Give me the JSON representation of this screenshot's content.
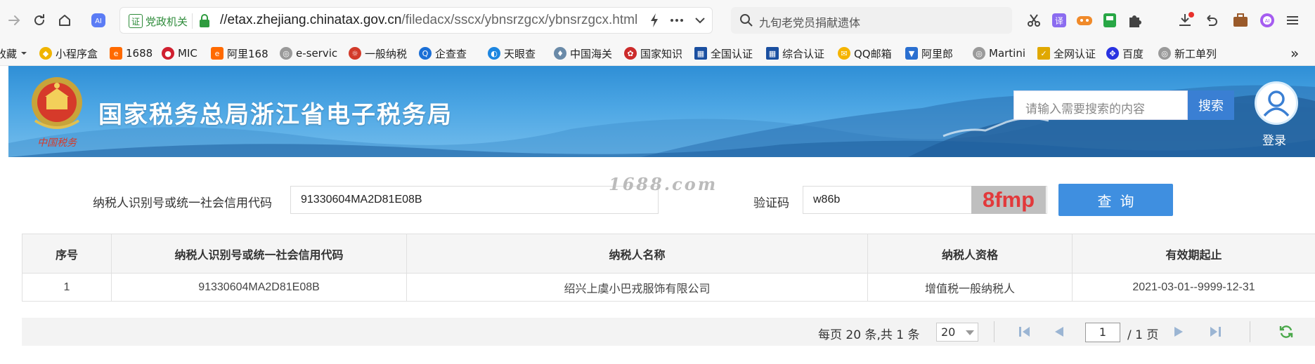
{
  "browser": {
    "address_badge": "党政机关",
    "address_badge_icon": "证",
    "url_host": "//etax.zhejiang.chinatax.gov.cn",
    "url_path": "/filedacx/sscx/ybnsrzgcx/ybnsrzgcx.html",
    "search_placeholder": "九旬老党员捐献遗体"
  },
  "bookmarks": {
    "items": [
      {
        "label": "收藏",
        "icon": "dropdown-caret-icon",
        "color": "#777777"
      },
      {
        "label": "小程序盒",
        "icon": "miniapp-icon",
        "color": "#f0b400"
      },
      {
        "label": "1688",
        "icon": "1688-icon",
        "color": "#ff6a00"
      },
      {
        "label": "MIC",
        "icon": "mic-icon",
        "color": "#d02030"
      },
      {
        "label": "阿里168",
        "icon": "alibaba-icon",
        "color": "#ff6a00"
      },
      {
        "label": "e-servic",
        "icon": "globe-icon",
        "color": "#8a8a8a"
      },
      {
        "label": "一般纳税",
        "icon": "tax-emblem-icon",
        "color": "#d23a2a"
      },
      {
        "label": "企查查",
        "icon": "qichacha-icon",
        "color": "#1b6fd6"
      },
      {
        "label": "天眼查",
        "icon": "tianyancha-icon",
        "color": "#1d86e0"
      },
      {
        "label": "中国海关",
        "icon": "customs-icon",
        "color": "#6a8aa8"
      },
      {
        "label": "国家知识",
        "icon": "ip-office-icon",
        "color": "#cc2b2b"
      },
      {
        "label": "全国认证",
        "icon": "certification-icon",
        "color": "#1a4fa0"
      },
      {
        "label": "综合认证",
        "icon": "certification-icon",
        "color": "#1a4fa0"
      },
      {
        "label": "QQ邮箱",
        "icon": "qq-mail-icon",
        "color": "#f5b400"
      },
      {
        "label": "阿里郎",
        "icon": "shield-icon",
        "color": "#2a6fd0"
      },
      {
        "label": "Martini",
        "icon": "globe-icon",
        "color": "#8a8a8a"
      },
      {
        "label": "全网认证",
        "icon": "check-icon",
        "color": "#e0a800"
      },
      {
        "label": "百度",
        "icon": "baidu-paw-icon",
        "color": "#2932e1"
      },
      {
        "label": "新工单列",
        "icon": "globe-icon",
        "color": "#8a8a8a"
      }
    ],
    "more": "»"
  },
  "banner": {
    "title": "国家税务总局浙江省电子税务局",
    "search_placeholder": "请输入需要搜索的内容",
    "search_button": "搜索",
    "login": "登录"
  },
  "form": {
    "taxpayer_id_label": "纳税人识别号或统一社会信用代码",
    "taxpayer_id_value": "91330604MA2D81E08B",
    "watermark": "1688.com",
    "captcha_label": "验证码",
    "captcha_value": "w86b",
    "captcha_image_text": "8fmp",
    "query_button": "查询"
  },
  "table": {
    "headers": [
      "序号",
      "纳税人识别号或统一社会信用代码",
      "纳税人名称",
      "纳税人资格",
      "有效期起止"
    ],
    "rows": [
      [
        "1",
        "91330604MA2D81E08B",
        "绍兴上虞小巴戎服饰有限公司",
        "增值税一般纳税人",
        "2021-03-01--9999-12-31"
      ]
    ]
  },
  "pager": {
    "summary": "每页 20 条,共 1 条",
    "page_size": "20",
    "current_page": "1",
    "total_pages": "/ 1 页"
  },
  "colors": {
    "banner_blue": "#2f8fd6",
    "query_button": "#3f8fe0",
    "captcha_text": "#e2393b"
  }
}
